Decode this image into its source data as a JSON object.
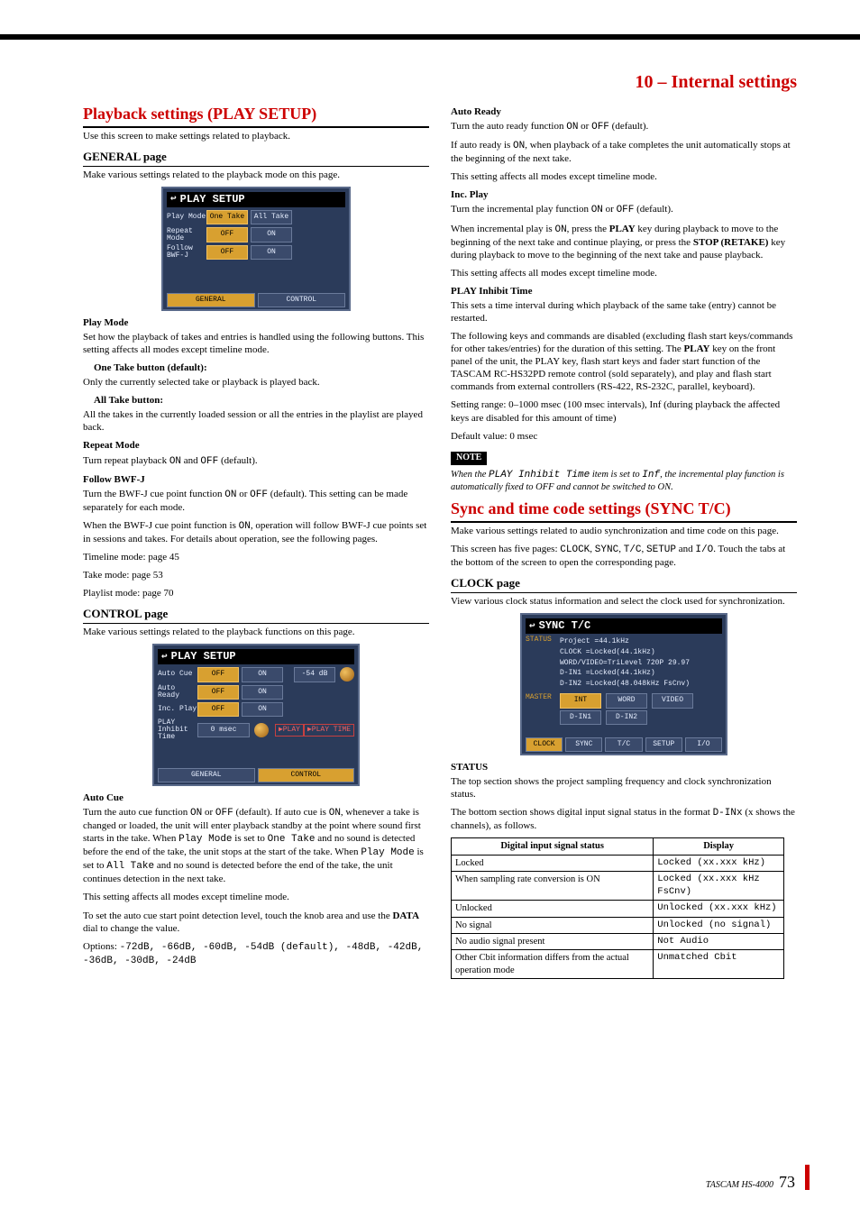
{
  "chapter": "10 – Internal settings",
  "left": {
    "h1": "Playback settings (PLAY SETUP)",
    "intro": "Use this screen to make settings related to playback.",
    "general": {
      "h": "GENERAL page",
      "p": "Make various settings related to the playback mode on this page.",
      "lcd_title": "PLAY SETUP",
      "rows": [
        {
          "lbl": "Play Mode",
          "a": "One Take",
          "b": "All Take",
          "sel": 0
        },
        {
          "lbl": "Repeat Mode",
          "a": "OFF",
          "b": "ON",
          "sel": 0
        },
        {
          "lbl": "Follow BWF-J",
          "a": "OFF",
          "b": "ON",
          "sel": 0
        }
      ],
      "tabs": [
        "GENERAL",
        "CONTROL"
      ],
      "tab_sel": 0
    },
    "play_mode": {
      "h": "Play Mode",
      "p": "Set how the playback of takes and entries is handled using the following buttons. This setting affects all modes except timeline mode.",
      "one_h": "One Take button (default):",
      "one_p": "Only the currently selected take or playback is played back.",
      "all_h": "All Take button:",
      "all_p": "All the takes in the currently loaded session or all the entries in the playlist are played back."
    },
    "repeat": {
      "h": "Repeat Mode",
      "p_pre": "Turn repeat playback ",
      "on": "ON",
      "mid": " and ",
      "off": "OFF",
      "p_post": " (default)."
    },
    "follow": {
      "h": "Follow BWF-J",
      "p1_pre": "Turn the BWF-J cue point function ",
      "on": "ON",
      "mid": " or ",
      "off": "OFF",
      "p1_post": " (default). This setting can be made separately for each mode.",
      "p2_pre": "When the BWF-J cue point function is ",
      "on2": "ON",
      "p2_post": ", operation will follow BWF-J cue points set in sessions and takes. For details about operation, see the following pages.",
      "l1": "Timeline mode: page 45",
      "l2": "Take mode: page 53",
      "l3": "Playlist mode: page 70"
    },
    "control": {
      "h": "CONTROL page",
      "p": "Make various settings related to the playback functions on this page.",
      "lcd_title": "PLAY SETUP",
      "rows": [
        {
          "lbl": "Auto Cue",
          "a": "OFF",
          "b": "ON",
          "knob": "-54 dB"
        },
        {
          "lbl": "Auto Ready",
          "a": "OFF",
          "b": "ON"
        },
        {
          "lbl": "Inc. Play",
          "a": "OFF",
          "b": "ON"
        },
        {
          "lbl": "PLAY Inhibit Time",
          "val": "0 msec",
          "s1": "▶PLAY",
          "s2": "▶PLAY TIME"
        }
      ],
      "tabs": [
        "GENERAL",
        "CONTROL"
      ],
      "tab_sel": 1
    },
    "autocue": {
      "h": "Auto Cue",
      "p1_a": "Turn the auto cue function ",
      "on": "ON",
      "mid": " or ",
      "off": "OFF",
      "p1_b": " (default). If auto cue is ",
      "on2": "ON",
      "p1_c": ", whenever a take is changed or loaded, the unit will enter playback standby at the point where sound first starts in the take. When ",
      "pm": "Play Mode",
      "p1_d": " is set to ",
      "ot": "One Take",
      "p1_e": " and no sound is detected before the end of the take, the unit stops at the start of the take. When ",
      "pm2": "Play Mode",
      "p1_f": " is set to ",
      "at": "All Take",
      "p1_g": " and no sound is detected before the end of the take, the unit continues detection in the next take.",
      "p2": "This setting affects all modes except timeline mode.",
      "p3a": "To set the auto cue start point detection level, touch the knob area and use the ",
      "data": "DATA",
      "p3b": " dial to change the value.",
      "opt_lbl": "Options:",
      "opts": "-72dB, -66dB, -60dB, -54dB (default), -48dB, -42dB, -36dB, -30dB, -24dB"
    }
  },
  "right": {
    "autoready": {
      "h": "Auto Ready",
      "p1a": "Turn the auto ready function ",
      "on": "ON",
      "mid": " or ",
      "off": "OFF",
      "p1b": " (default).",
      "p2a": "If auto ready is ",
      "on2": "ON",
      "p2b": ", when playback of a take completes the unit automatically stops at the beginning of the next take.",
      "p3": "This setting affects all modes except timeline mode."
    },
    "incplay": {
      "h": "Inc. Play",
      "p1a": "Turn the incremental play function ",
      "on": "ON",
      "mid": " or ",
      "off": "OFF",
      "p1b": " (default).",
      "p2a": "When incremental play is ",
      "on2": "ON",
      "p2b": ", press the ",
      "play": "PLAY",
      "p2c": " key during playback to move to the beginning of the next take and continue playing, or press the ",
      "stop": "STOP (RETAKE)",
      "p2d": " key during playback to move to the beginning of the next take and pause playback.",
      "p3": "This setting affects all modes except timeline mode."
    },
    "inhibit": {
      "h": "PLAY Inhibit Time",
      "p1": "This sets a time interval during which playback of the same take (entry) cannot be restarted.",
      "p2a": "The following keys and commands are disabled (excluding flash start keys/commands for other takes/entries) for the duration of this setting. The ",
      "play": "PLAY",
      "p2b": " key on the front panel of the unit, the PLAY key, flash start keys and fader start function of the TASCAM RC-HS32PD remote control (sold separately), and play and flash start commands from external controllers (RS-422, RS-232C, parallel, keyboard).",
      "p3": "Setting range: 0–1000 msec (100 msec intervals), Inf (during playback the affected keys are disabled for this amount of time)",
      "p4": "Default value: 0 msec",
      "note": "NOTE",
      "note_a": "When the ",
      "note_item": "PLAY Inhibit Time",
      "note_b": " item is set to ",
      "note_inf": "Inf",
      "note_c": ", the incremental play function is automatically fixed to OFF and cannot be switched to ON."
    },
    "sync": {
      "h1": "Sync and time code settings (SYNC T/C)",
      "p1": "Make various settings related to audio synchronization and time code on this page.",
      "p2a": "This screen has five pages: ",
      "p_clock": "CLOCK",
      "p_sync": "SYNC",
      "p_tc": "T/C",
      "p_setup": "SETUP",
      "p_io": "I/O",
      "p2b": ". Touch the tabs at the bottom of the screen to open the corresponding page."
    },
    "clock": {
      "h": "CLOCK page",
      "p": "View various clock status information and select the clock used for synchronization.",
      "lcd_title": "SYNC T/C",
      "status_lines": [
        "Project =44.1kHz",
        "CLOCK   =Locked(44.1kHz)",
        "WORD/VIDEO=TriLevel 720P 29.97",
        "D-IN1   =Locked(44.1kHz)",
        "D-IN2   =Locked(48.048kHz FsCnv)"
      ],
      "master_lbl": "MASTER",
      "master_btns": [
        "INT",
        "WORD",
        "VIDEO",
        "D-IN1",
        "D-IN2"
      ],
      "tabs": [
        "CLOCK",
        "SYNC",
        "T/C",
        "SETUP",
        "I/O"
      ],
      "tab_sel": 0
    },
    "status": {
      "h": "STATUS",
      "p1": "The top section shows the project sampling frequency and clock synchronization status.",
      "p2a": "The bottom section shows digital input signal status in the format ",
      "dinx": "D-INx",
      "p2b": " (x shows the channels), as follows."
    },
    "table": {
      "th1": "Digital input signal status",
      "th2": "Display",
      "rows": [
        {
          "a": "Locked",
          "b": "Locked (xx.xxx kHz)"
        },
        {
          "a": "When sampling rate conversion is ON",
          "b": "Locked (xx.xxx kHz FsCnv)"
        },
        {
          "a": "Unlocked",
          "b": "Unlocked (xx.xxx kHz)"
        },
        {
          "a": "No signal",
          "b": "Unlocked (no signal)"
        },
        {
          "a": "No audio signal present",
          "b": "Not Audio"
        },
        {
          "a": "Other Cbit information differs from the actual operation mode",
          "b": "Unmatched Cbit"
        }
      ]
    }
  },
  "footer": {
    "model": "TASCAM HS-4000",
    "page": "73"
  }
}
